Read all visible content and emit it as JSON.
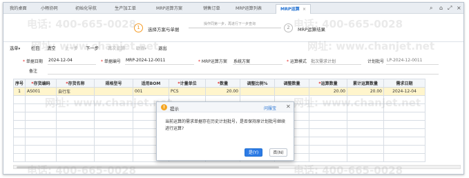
{
  "tabs": [
    "我的桌面",
    "小畅协同",
    "初始化导航",
    "生产加工单",
    "MRP运算方案",
    "销售订单",
    "MRP运算列表",
    "MRP运算"
  ],
  "active_tab_close": "×",
  "window_controls": [
    "⌕",
    "⌂",
    "⤢",
    "×"
  ],
  "wizard": {
    "step1_num": "1",
    "step1_label": "选择方案与单据",
    "hint": "操作同第一步，再进行下一步查询",
    "step2_num": "2",
    "step2_label": "MRP运算结果"
  },
  "toolbar": {
    "items": [
      "选单",
      "栏目",
      "清空",
      "上一步",
      "下一步",
      "再次运算",
      "联查",
      "退出"
    ],
    "disabled": [
      false,
      false,
      false,
      true,
      false,
      true,
      true,
      false
    ]
  },
  "form": {
    "date_label": "单据日期",
    "date_value": "2024-12-04",
    "no_label": "单据编号",
    "no_value": "MRP-2024-12-0011",
    "scheme_label": "MRP运算方案",
    "scheme_value": "系统方案",
    "mode_label": "运算模式",
    "mode_value": "批次需求计划",
    "plan_label": "计划批号",
    "plan_value": "LP-2024-12-0011",
    "remark_label": "备注"
  },
  "grid": {
    "headers": [
      "序号",
      "存货编码",
      "存货名称",
      "规格型号",
      "适用BOM",
      "计量单位",
      "数量",
      "调整比例%",
      "调整数量",
      "运算数量",
      "累计运算数量",
      "需求日期"
    ],
    "required": [
      false,
      true,
      true,
      false,
      false,
      true,
      true,
      false,
      false,
      true,
      false,
      false
    ],
    "rows": [
      [
        "1",
        "AS001",
        "自行车",
        "",
        "001",
        "PCS",
        "20.00",
        "",
        "",
        "20.00",
        "20.00",
        "2024-12-04"
      ]
    ]
  },
  "watermark": {
    "phone": "电话: 400-665-0028",
    "site": "网址: www.chanjet.net"
  },
  "dialog": {
    "title": "提示",
    "help": "问服宝",
    "close": "✕",
    "message": "当前运算的需求单据存在历史计划批号，是否保持原计划批号继续进行运算?",
    "yes": "是(Y)",
    "no": "否(N)",
    "icon_glyph": "!"
  }
}
